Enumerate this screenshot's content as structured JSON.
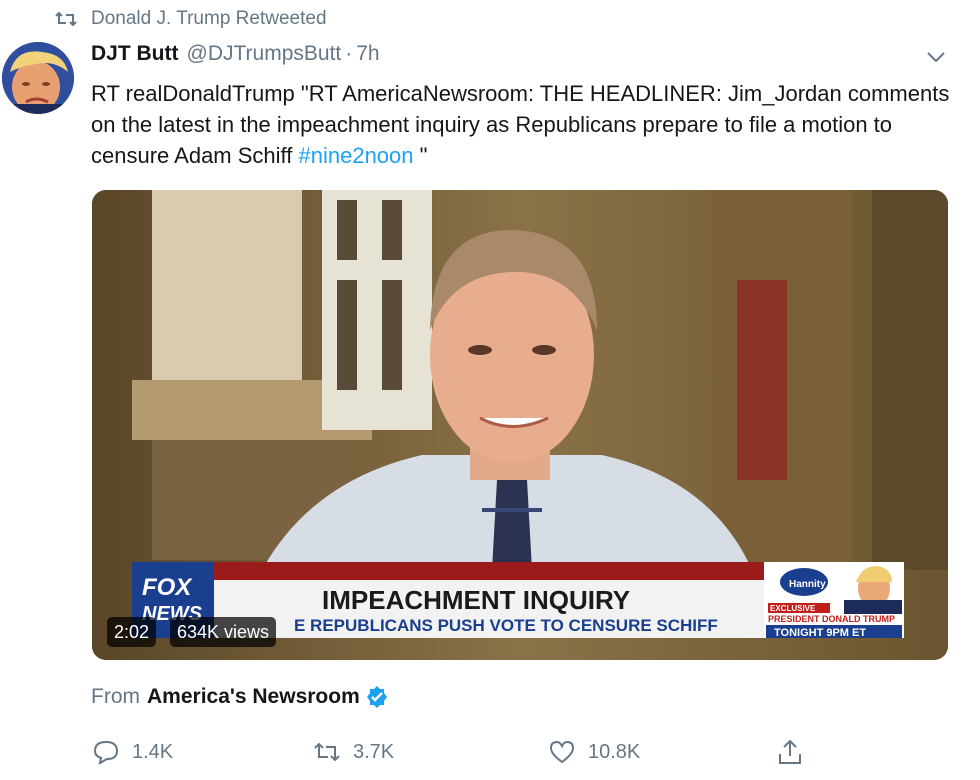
{
  "retweet_context": {
    "text": "Donald J. Trump Retweeted",
    "icon": "retweet-icon"
  },
  "tweet": {
    "author_name": "DJT Butt",
    "author_handle": "@DJTrumpsButt",
    "separator": "·",
    "time": "7h",
    "text_pre": "RT realDonaldTrump \"RT AmericaNewsroom: THE HEADLINER: Jim_Jordan comments on the latest in the impeachment inquiry as Republicans prepare to file a motion to censure Adam Schiff ",
    "hashtag": "#nine2noon",
    "text_post": " \""
  },
  "video": {
    "duration": "2:02",
    "views": "634K views",
    "network_logo": "FOX NEWS",
    "chyron_headline": "IMPEACHMENT INQUIRY",
    "chyron_subline": "E REPUBLICANS PUSH VOTE TO CENSURE SCHIFF",
    "promo_show": "Hannity",
    "promo_line1": "EXCLUSIVE",
    "promo_line2": "PRESIDENT DONALD TRUMP",
    "promo_line3": "TONIGHT 9PM ET"
  },
  "source": {
    "prefix": "From",
    "name": "America's Newsroom",
    "verified_icon": "verified-badge-icon"
  },
  "actions": {
    "replies": "1.4K",
    "retweets": "3.7K",
    "likes": "10.8K"
  },
  "colors": {
    "link": "#1da1f2",
    "muted": "#657786",
    "text": "#14171a",
    "chyron_red": "#9b1b1b",
    "chyron_blue": "#1a3f8f"
  }
}
